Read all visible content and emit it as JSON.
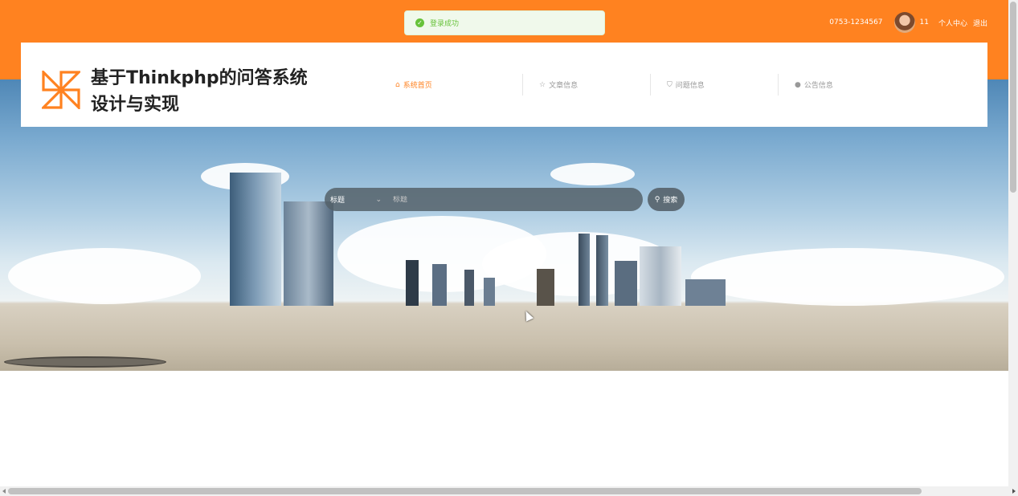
{
  "top_bar": {
    "phone": "0753-1234567",
    "username": "11",
    "user_center": "个人中心",
    "logout": "退出",
    "bg_color": "#ff8220"
  },
  "toast": {
    "message": "登录成功",
    "icon": "success-check-icon",
    "color": "#67c23a"
  },
  "header": {
    "title_line1": "基于Thinkphp的问答系统",
    "title_line2": "设计与实现",
    "logo_icon": "pinwheel-logo-icon"
  },
  "nav": {
    "items": [
      {
        "label": "系统首页",
        "icon": "home-icon",
        "active": true
      },
      {
        "label": "文章信息",
        "icon": "star-icon",
        "active": false
      },
      {
        "label": "问题信息",
        "icon": "bag-icon",
        "active": false
      },
      {
        "label": "公告信息",
        "icon": "info-icon",
        "active": false
      }
    ],
    "active_color": "#ff8220"
  },
  "search": {
    "select_value": "标题",
    "placeholder": "标题",
    "button_label": "搜索"
  }
}
